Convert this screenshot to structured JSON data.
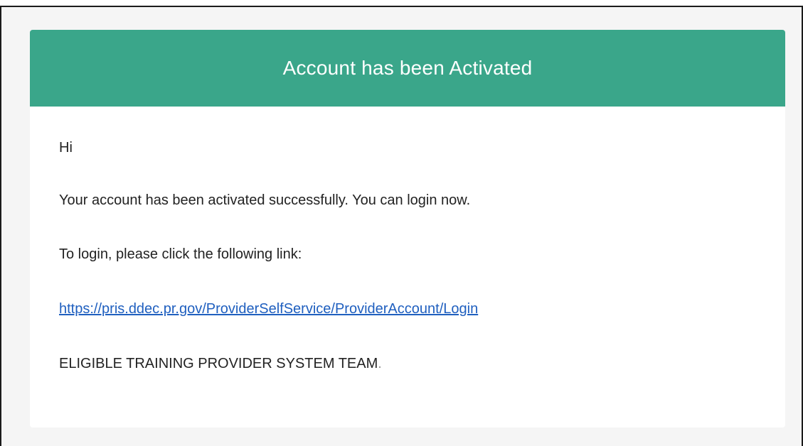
{
  "email": {
    "header_title": "Account has been Activated",
    "greeting": "Hi",
    "message": "Your account has been activated successfully. You can login now.",
    "instruction": "To login, please click the following link:",
    "login_link": "https://pris.ddec.pr.gov/ProviderSelfService/ProviderAccount/Login",
    "signature": "ELIGIBLE TRAINING PROVIDER SYSTEM TEAM",
    "signature_end": "."
  },
  "colors": {
    "header_bg": "#3aa68a",
    "link": "#1f5fbf",
    "page_bg": "#f5f5f5"
  }
}
